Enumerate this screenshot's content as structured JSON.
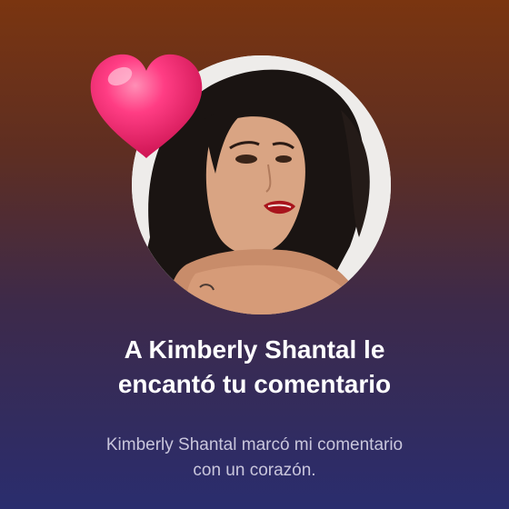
{
  "notification": {
    "title_line1": "A Kimberly Shantal le",
    "title_line2": "encantó tu comentario",
    "subtitle_line1": "Kimberly Shantal marcó mi comentario",
    "subtitle_line2": "con un corazón."
  },
  "icons": {
    "reaction": "heart-icon"
  },
  "colors": {
    "heart": "#ff2d7a",
    "title": "#ffffff",
    "subtitle": "#c9c6dc",
    "background_top": "#7a3510",
    "background_bottom": "#2a2d6e"
  }
}
